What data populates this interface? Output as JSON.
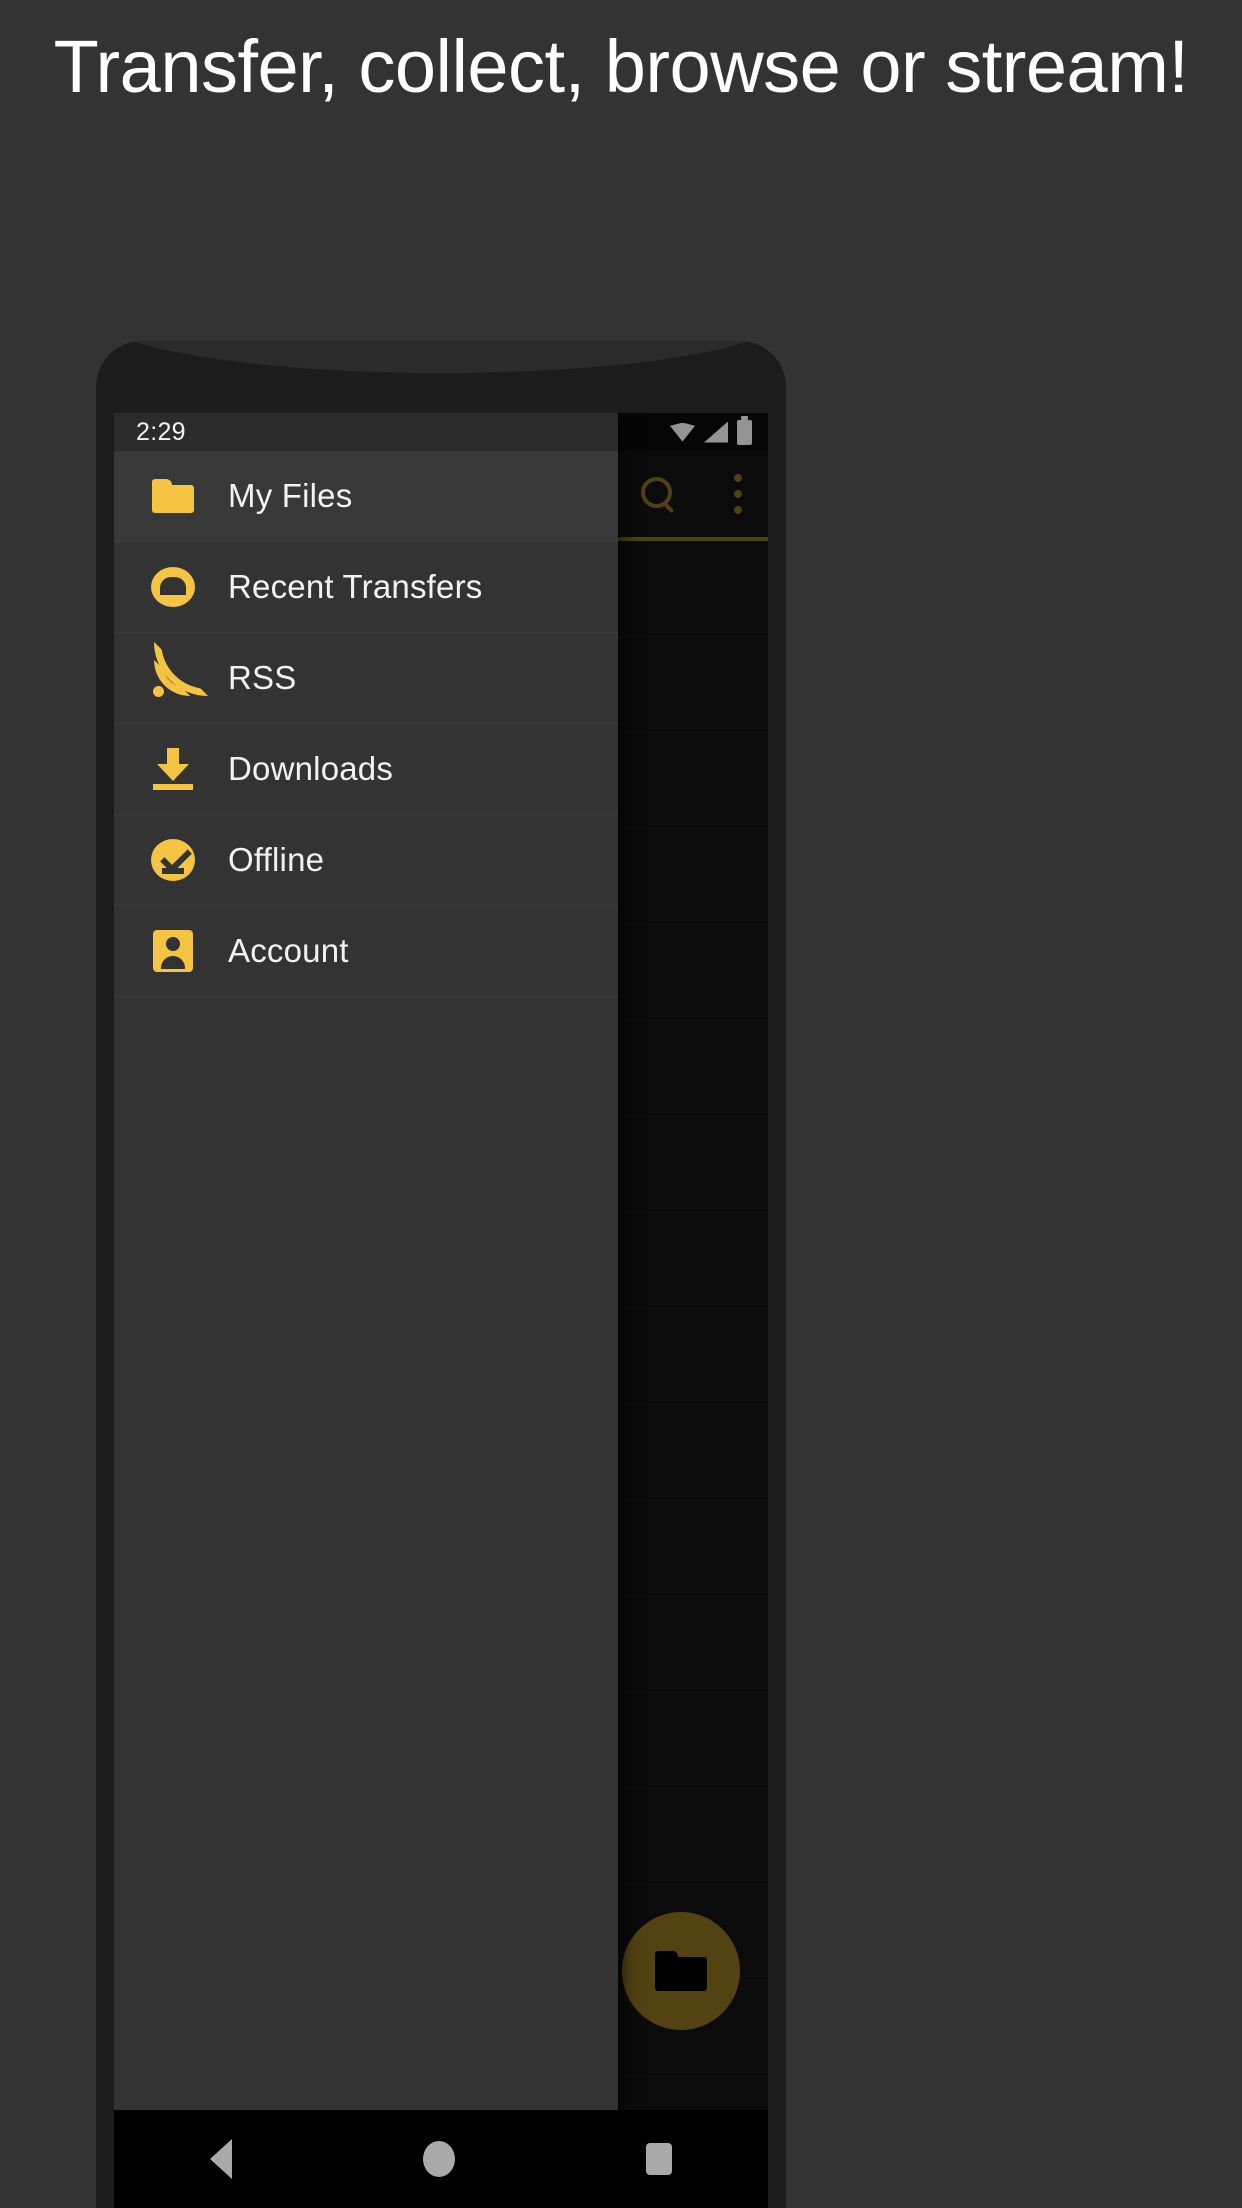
{
  "headline": "Transfer, collect, browse or stream!",
  "colors": {
    "page_background": "#333333",
    "accent_gold": "#f5c443",
    "dim_gold": "#8a6f1f",
    "fab_gold": "#8f7420",
    "drawer_background": "#333333",
    "text_primary": "#f2f2f2"
  },
  "phone": {
    "status_bar": {
      "time": "2:29",
      "icons": [
        "wifi-icon",
        "signal-icon",
        "battery-icon"
      ]
    },
    "toolbar": {
      "search_icon": "search-icon",
      "overflow_icon": "overflow-menu-icon"
    },
    "fab": {
      "icon": "folder-icon"
    },
    "nav_bar": {
      "back": "back-triangle-icon",
      "home": "home-circle-icon",
      "recents": "recents-square-icon"
    }
  },
  "drawer": {
    "items": [
      {
        "label": "My Files",
        "icon": "folder-icon",
        "selected": true
      },
      {
        "label": "Recent Transfers",
        "icon": "cloud-icon",
        "selected": false
      },
      {
        "label": "RSS",
        "icon": "rss-icon",
        "selected": false
      },
      {
        "label": "Downloads",
        "icon": "download-icon",
        "selected": false
      },
      {
        "label": "Offline",
        "icon": "offline-icon",
        "selected": false
      },
      {
        "label": "Account",
        "icon": "account-icon",
        "selected": false
      }
    ]
  }
}
